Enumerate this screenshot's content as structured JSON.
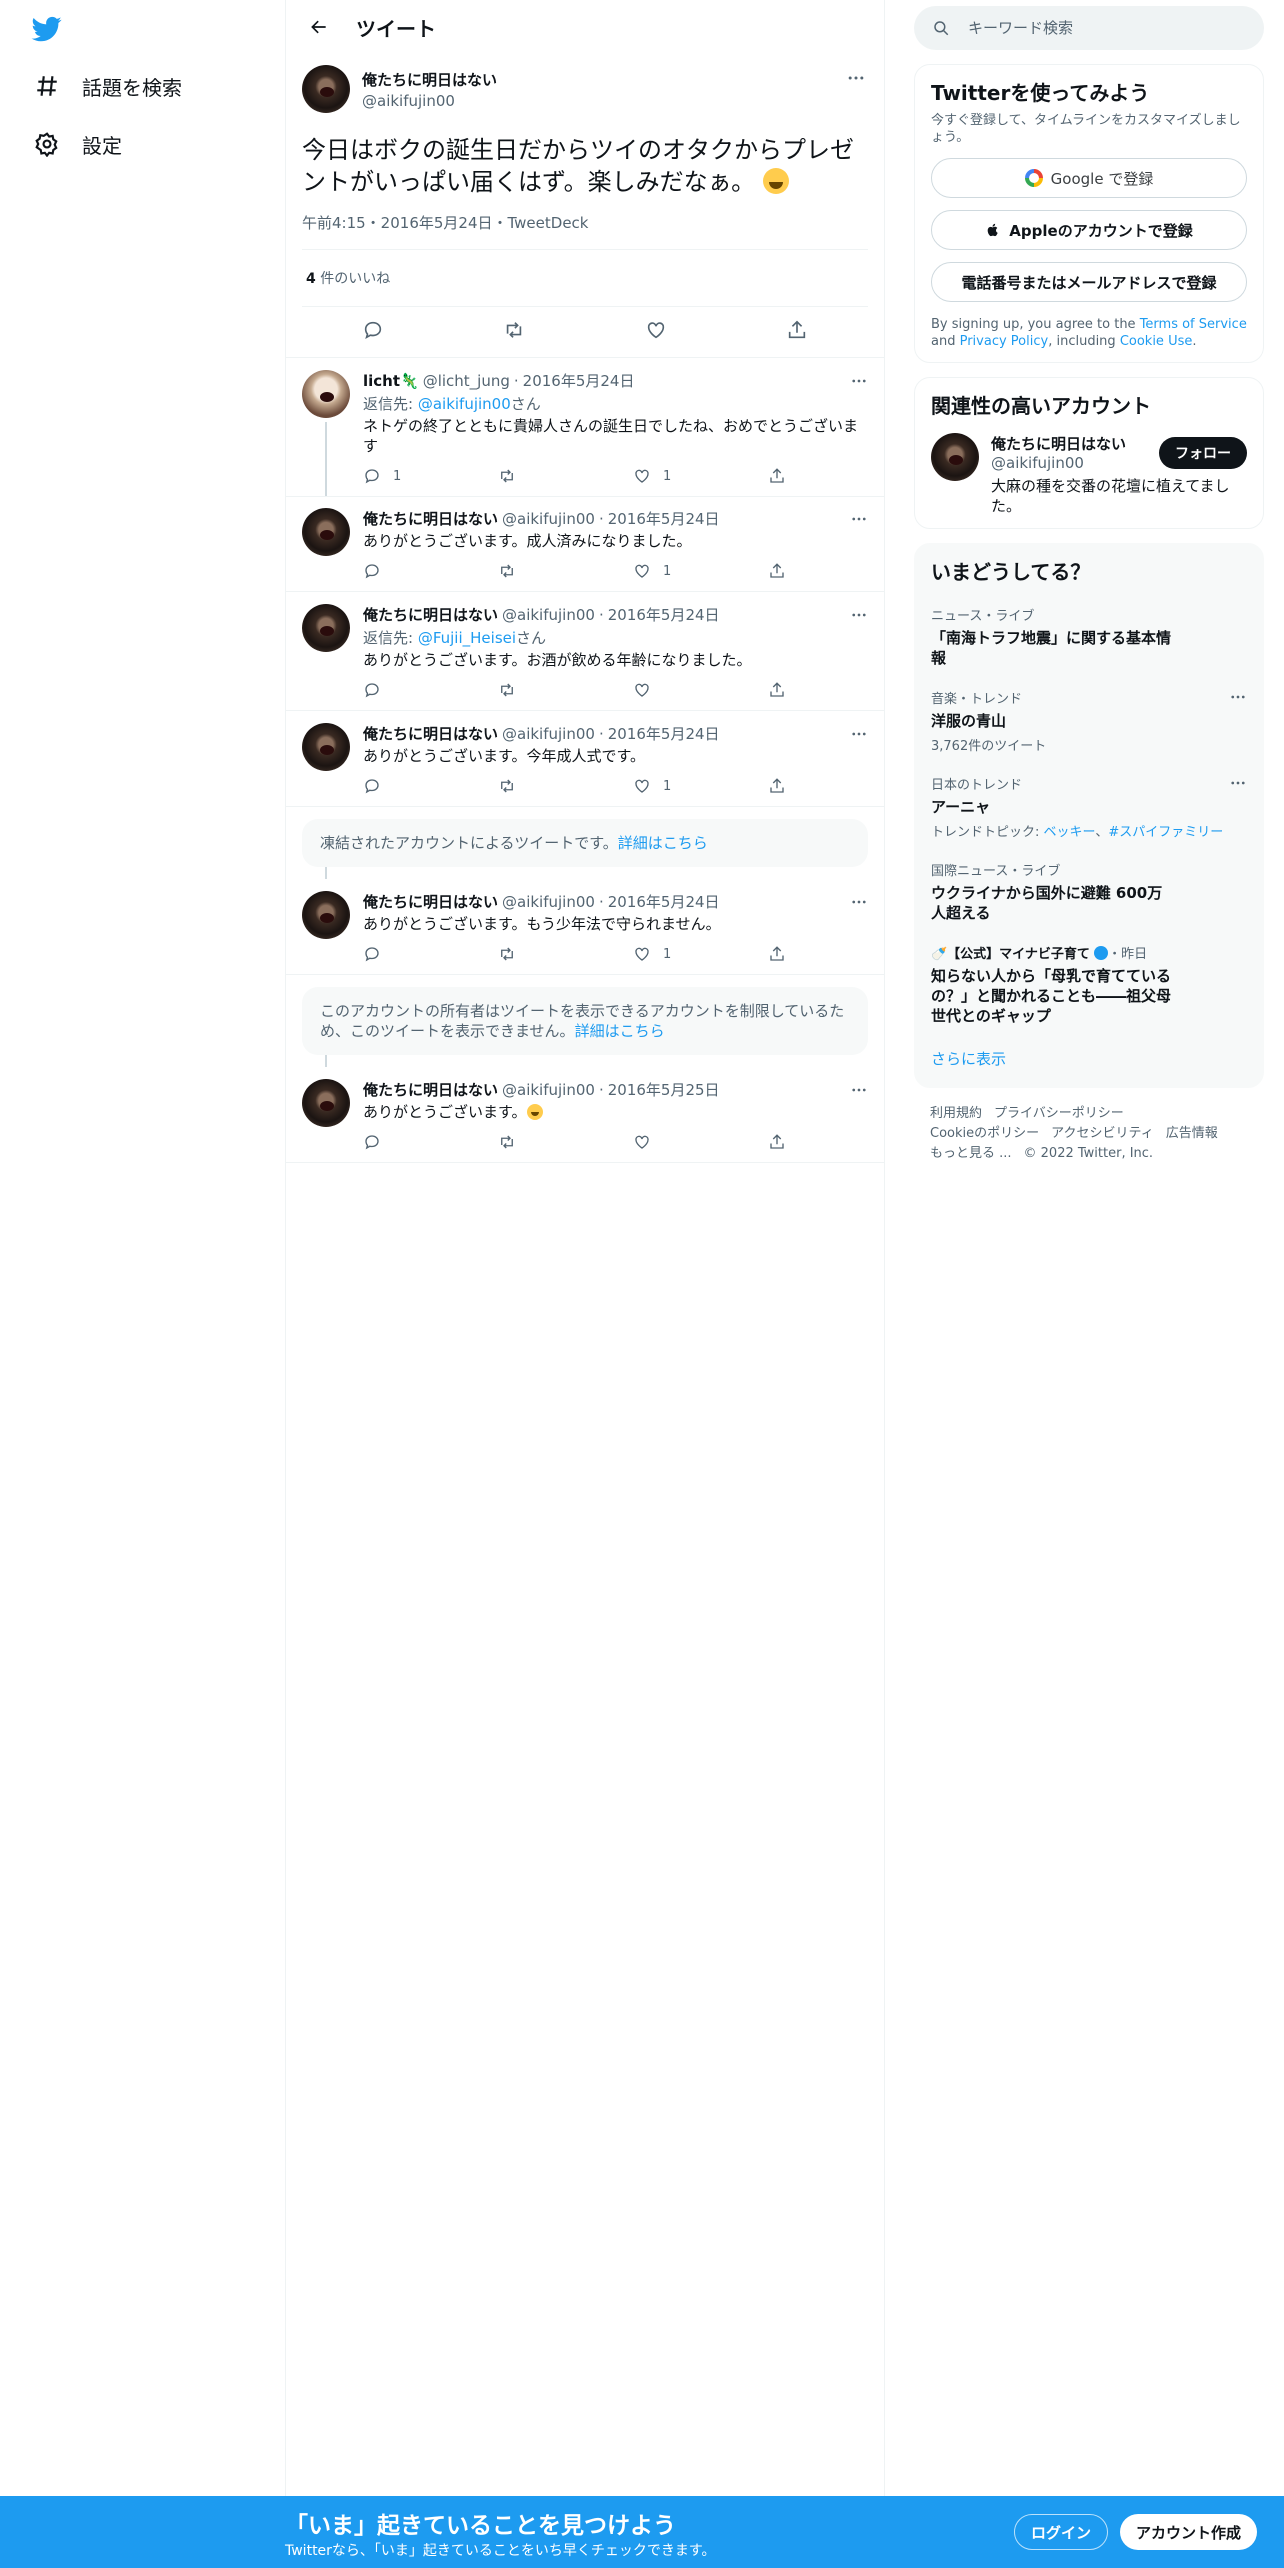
{
  "nav": {
    "items": [
      {
        "label": "話題を検索",
        "icon": "hashtag-icon"
      },
      {
        "label": "設定",
        "icon": "gear-icon"
      }
    ]
  },
  "header": {
    "title": "ツイート"
  },
  "main_tweet": {
    "name": "俺たちに明日はない",
    "handle": "@aikifujin00",
    "text": "今日はボクの誕生日だからツイのオタクからプレゼントがいっぱい届くはず。楽しみだなぁ。",
    "meta": "午前4:15・2016年5月24日・TweetDeck",
    "likes_count": "4",
    "likes_label": " 件のいいね"
  },
  "replies": [
    {
      "name": "licht🦎",
      "handle": "@licht_jung",
      "date": "2016年5月24日",
      "reply_prefix": "返信先: ",
      "reply_to": "@aikifujin00",
      "reply_suffix": "さん",
      "text": "ネトゲの終了とともに貴婦人さんの誕生日でしたね、おめでとうございます",
      "reply_count": "1",
      "retweet_count": "",
      "like_count": "1"
    },
    {
      "name": "俺たちに明日はない",
      "handle": "@aikifujin00",
      "date": "2016年5月24日",
      "text": "ありがとうございます。成人済みになりました。",
      "reply_count": "",
      "retweet_count": "",
      "like_count": "1"
    },
    {
      "name": "俺たちに明日はない",
      "handle": "@aikifujin00",
      "date": "2016年5月24日",
      "reply_prefix": "返信先: ",
      "reply_to": "@Fujii_Heisei",
      "reply_suffix": "さん",
      "text": "ありがとうございます。お酒が飲める年齢になりました。",
      "reply_count": "",
      "retweet_count": "",
      "like_count": ""
    },
    {
      "name": "俺たちに明日はない",
      "handle": "@aikifujin00",
      "date": "2016年5月24日",
      "text": "ありがとうございます。今年成人式です。",
      "reply_count": "",
      "retweet_count": "",
      "like_count": "1"
    },
    {
      "name": "俺たちに明日はない",
      "handle": "@aikifujin00",
      "date": "2016年5月24日",
      "text": "ありがとうございます。もう少年法で守られません。",
      "reply_count": "",
      "retweet_count": "",
      "like_count": "1"
    },
    {
      "name": "俺たちに明日はない",
      "handle": "@aikifujin00",
      "date": "2016年5月25日",
      "text": "ありがとうございます。",
      "reply_count": "",
      "retweet_count": "",
      "like_count": ""
    }
  ],
  "notices": [
    {
      "text": "凍結されたアカウントによるツイートです。",
      "link": "詳細はこちら"
    },
    {
      "text": "このアカウントの所有者はツイートを表示できるアカウントを制限しているため、このツイートを表示できません。",
      "link": "詳細はこちら"
    }
  ],
  "search": {
    "placeholder": "キーワード検索"
  },
  "signup_card": {
    "title": "Twitterを使ってみよう",
    "subtitle": "今すぐ登録して、タイムラインをカスタマイズしましょう。",
    "google_label": "Google で登録",
    "apple_label": "Appleのアカウントで登録",
    "phone_label": "電話番号またはメールアドレスで登録",
    "terms_prefix": "By signing up, you agree to the ",
    "terms_link": "Terms of Service",
    "terms_and": " and ",
    "privacy_link": "Privacy Policy",
    "terms_including": ", including ",
    "cookie_link": "Cookie Use",
    "terms_end": "."
  },
  "related": {
    "title": "関連性の高いアカウント",
    "name": "俺たちに明日はない",
    "handle": "@aikifujin00",
    "bio": "大麻の種を交番の花壇に植えてました。",
    "follow_label": "フォロー"
  },
  "trends": {
    "title": "いまどうしてる？",
    "items": [
      {
        "category": "ニュース・ライブ",
        "title": "「南海トラフ地震」に関する基本情報"
      },
      {
        "category": "音楽・トレンド",
        "title": "洋服の青山",
        "count": "3,762件のツイート"
      },
      {
        "category": "日本のトレンド",
        "title": "アーニャ",
        "topics_prefix": "トレンドトピック: ",
        "topic1": "ベッキー",
        "topic_sep": "、",
        "topic2": "#スパイファミリー"
      },
      {
        "category": "国際ニュース・ライブ",
        "title": "ウクライナから国外に避難 600万人超える"
      },
      {
        "source_name": "🍼【公式】マイナビ子育て",
        "source_time": "・昨日",
        "title": "知らない人から「母乳で育てているの？」と聞かれることも――祖父母世代とのギャップ"
      }
    ],
    "show_more": "さらに表示"
  },
  "footer": {
    "links": [
      "利用規約",
      "プライバシーポリシー",
      "Cookieのポリシー",
      "アクセシビリティ",
      "広告情報",
      "もっと見る ..."
    ],
    "copyright": "© 2022 Twitter, Inc."
  },
  "bottom_bar": {
    "title": "「いま」起きていることを見つけよう",
    "subtitle": "Twitterなら、「いま」起きていることをいち早くチェックできます。",
    "login_label": "ログイン",
    "signup_label": "アカウント作成"
  },
  "colors": {
    "accent": "#1d9bf0",
    "text": "#0f1419",
    "muted": "#536471"
  }
}
